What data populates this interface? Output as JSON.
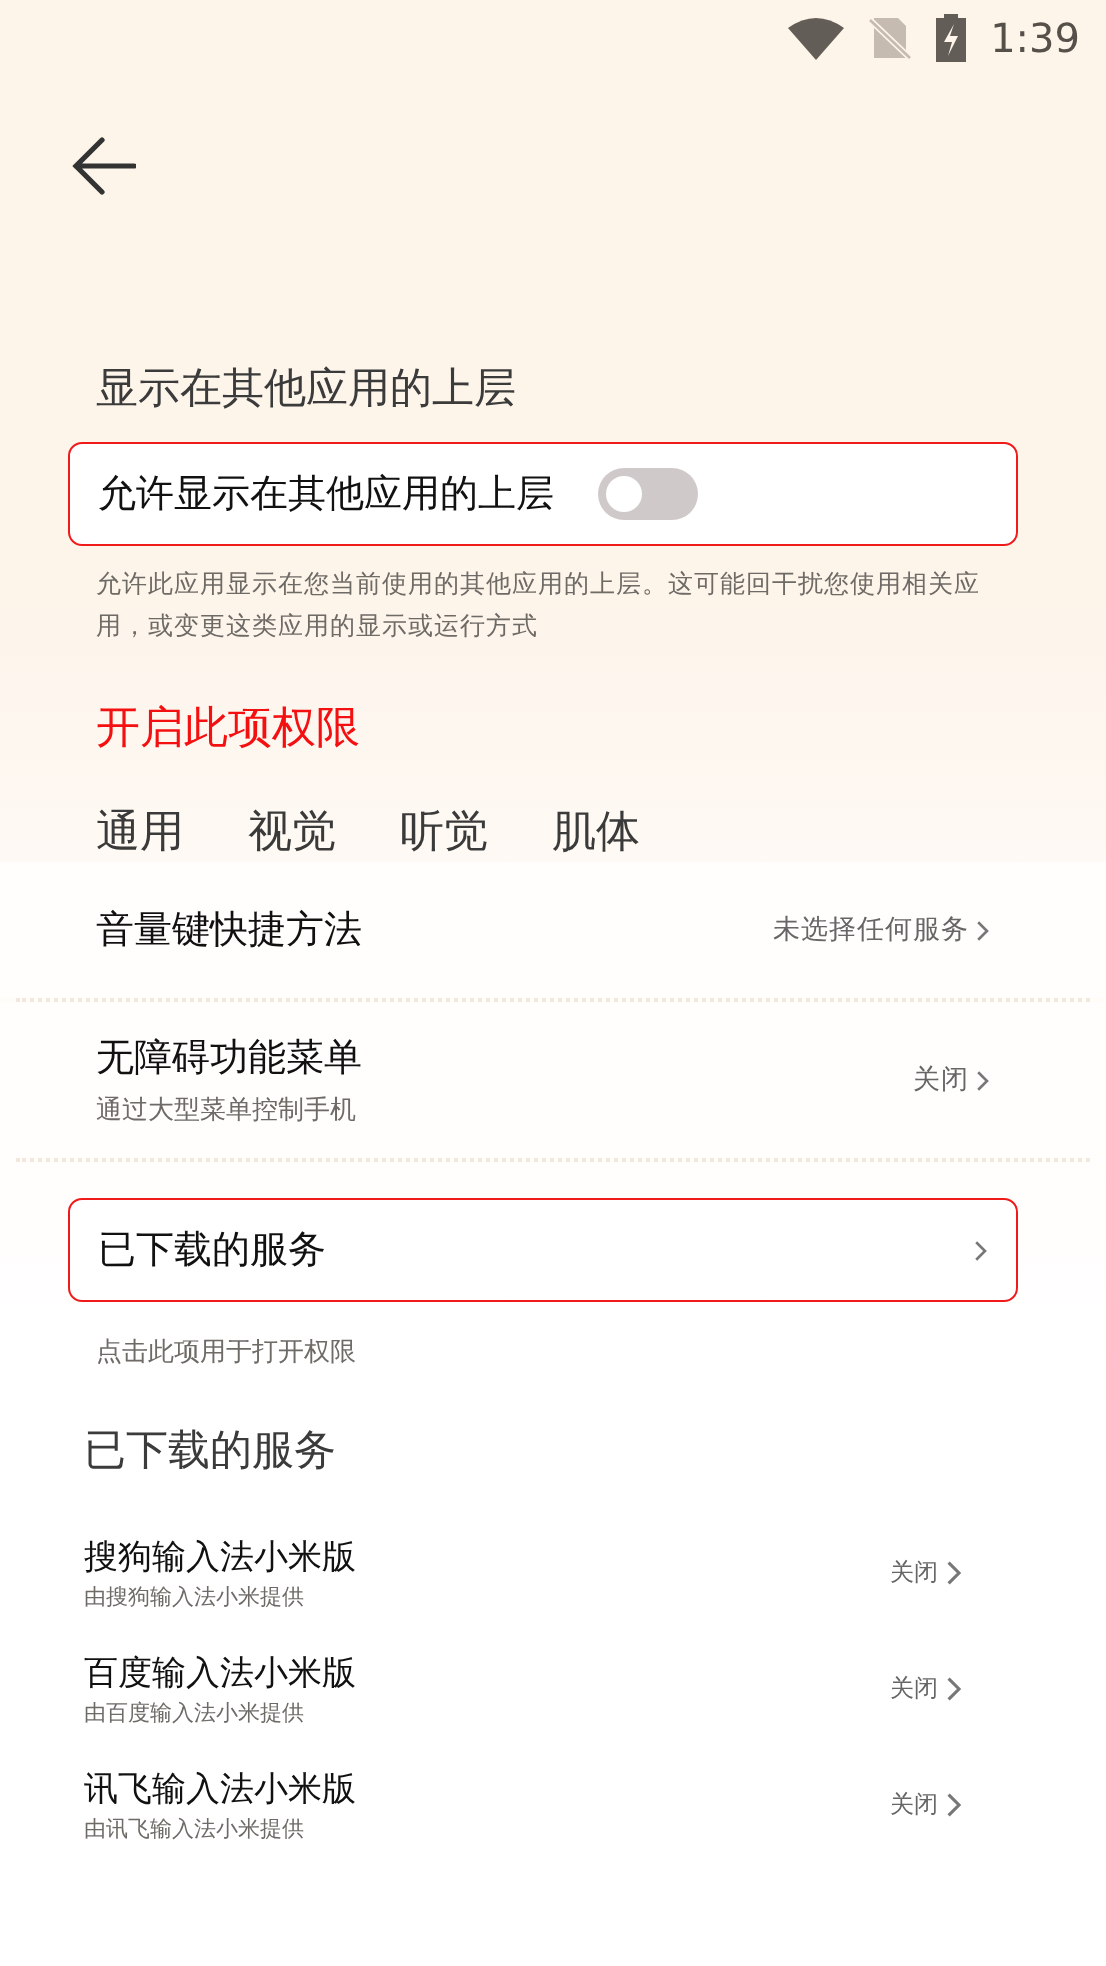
{
  "status_bar": {
    "time": "1:39"
  },
  "overlay_section": {
    "title": "显示在其他应用的上层",
    "toggle": {
      "label": "允许显示在其他应用的上层",
      "on": false,
      "highlighted": true
    },
    "description": "允许此应用显示在您当前使用的其他应用的上层。这可能回干扰您使用相关应用，或变更这类应用的显示或运行方式"
  },
  "annotation": "开启此项权限",
  "tabs": [
    {
      "label": "通用",
      "selected": false
    },
    {
      "label": "视觉",
      "selected": false
    },
    {
      "label": "听觉",
      "selected": false
    },
    {
      "label": "肌体",
      "selected": false
    }
  ],
  "settings": [
    {
      "title": "音量键快捷方法",
      "value": "未选择任何服务"
    },
    {
      "title": "无障碍功能菜单",
      "subtitle": "通过大型菜单控制手机",
      "value": "关闭"
    }
  ],
  "downloaded_row": {
    "title": "已下载的服务",
    "highlighted": true
  },
  "hint": "点击此项用于打开权限",
  "services_section": {
    "title": "已下载的服务",
    "items": [
      {
        "title": "搜狗输入法小米版",
        "subtitle": "由搜狗输入法小米提供",
        "value": "关闭"
      },
      {
        "title": "百度输入法小米版",
        "subtitle": "由百度输入法小米提供",
        "value": "关闭"
      },
      {
        "title": "讯飞输入法小米版",
        "subtitle": "由讯飞输入法小米提供",
        "value": "关闭"
      }
    ]
  }
}
